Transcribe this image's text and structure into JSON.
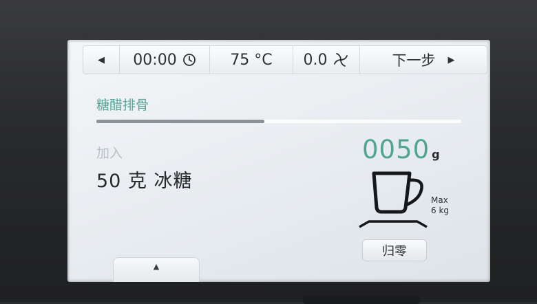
{
  "topbar": {
    "prev_glyph": "◀",
    "time": "00:00",
    "temperature": "75 °C",
    "speed": "0.0",
    "next_label": "下一步",
    "next_glyph": "▶"
  },
  "recipe": {
    "title": "糖醋排骨",
    "progress": 0.46
  },
  "step": {
    "label": "加入",
    "text": "50 克 冰糖"
  },
  "scale": {
    "weight": "0050",
    "unit": "g",
    "max_line1": "Max",
    "max_line2": "6 kg",
    "tare_label": "归零"
  },
  "bottom_tab": {
    "glyph": "▲"
  },
  "colors": {
    "accent_green": "#5aa79a",
    "weight_green": "#4fa590",
    "progress_fill": "#8a9298",
    "text_dark": "#25292c"
  },
  "icons": {
    "prev": "caret-left-icon",
    "clock": "clock-icon",
    "speed": "fan-icon",
    "next": "caret-right-icon",
    "scale": "scale-cup-icon",
    "up": "caret-up-icon"
  }
}
